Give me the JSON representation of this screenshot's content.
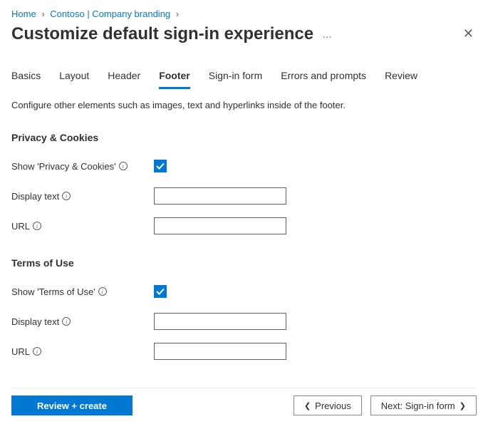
{
  "breadcrumb": {
    "home": "Home",
    "company": "Contoso | Company branding"
  },
  "header": {
    "title": "Customize default sign-in experience"
  },
  "tabs": [
    "Basics",
    "Layout",
    "Header",
    "Footer",
    "Sign-in form",
    "Errors and prompts",
    "Review"
  ],
  "activeTab": "Footer",
  "description": "Configure other elements such as images, text and hyperlinks inside of the footer.",
  "sections": {
    "privacy": {
      "title": "Privacy & Cookies",
      "showLabel": "Show 'Privacy & Cookies'",
      "showChecked": true,
      "displayTextLabel": "Display text",
      "displayTextValue": "",
      "urlLabel": "URL",
      "urlValue": ""
    },
    "terms": {
      "title": "Terms of Use",
      "showLabel": "Show 'Terms of Use'",
      "showChecked": true,
      "displayTextLabel": "Display text",
      "displayTextValue": "",
      "urlLabel": "URL",
      "urlValue": ""
    }
  },
  "footer": {
    "review": "Review + create",
    "previous": "Previous",
    "next": "Next: Sign-in form"
  }
}
